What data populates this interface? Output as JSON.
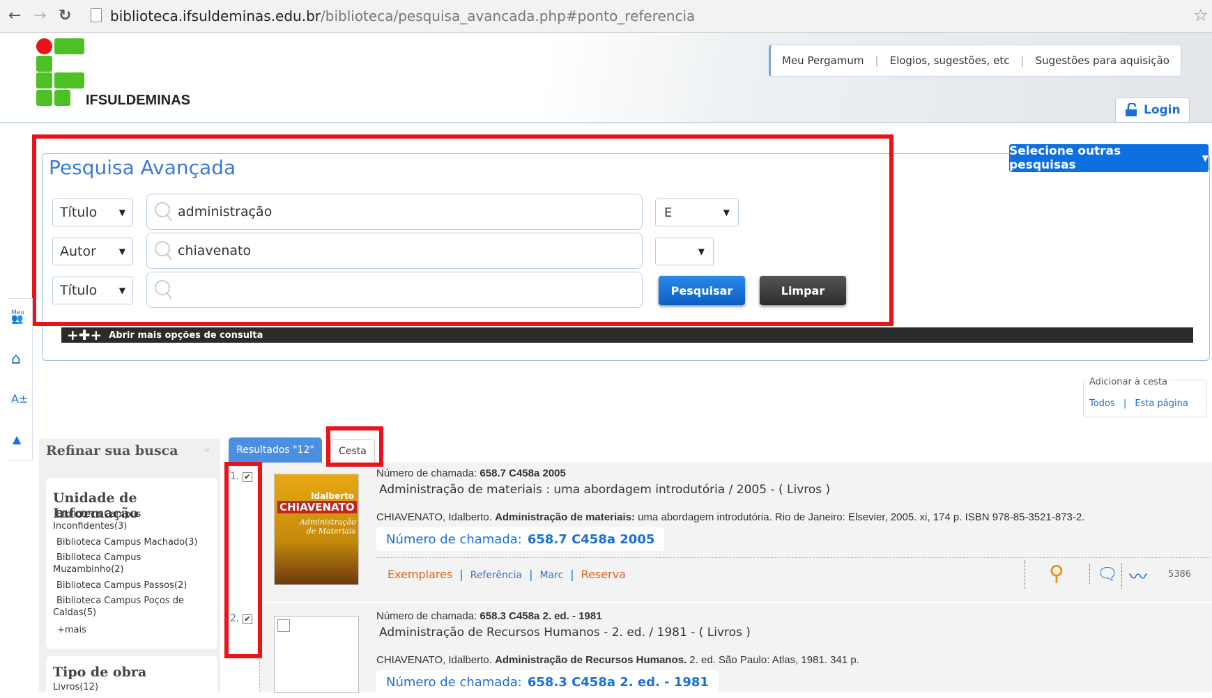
{
  "browser": {
    "url_domain": "biblioteca.ifsuldeminas.edu.br",
    "url_path": "/biblioteca/pesquisa_avancada.php#ponto_referencia"
  },
  "header": {
    "logo_text": "IFSULDEMINAS",
    "links": [
      "Meu Pergamum",
      "Elogios, sugestões, etc",
      "Sugestões para aquisição"
    ],
    "login": "Login"
  },
  "search": {
    "title": "Pesquisa Avançada",
    "other_searches": "Selecione outras pesquisas",
    "rows": [
      {
        "field": "Título",
        "term": "administração",
        "operator": "E"
      },
      {
        "field": "Autor",
        "term": "chiavenato",
        "operator": ""
      },
      {
        "field": "Título",
        "term": ""
      }
    ],
    "search_button": "Pesquisar",
    "clear_button": "Limpar",
    "more_options": "Abrir mais opções de consulta"
  },
  "sidetools": {
    "meu_label": "Meu",
    "font_label": "A±"
  },
  "basket": {
    "legend": "Adicionar à cesta",
    "all": "Todos",
    "this_page": "Esta página"
  },
  "refine": {
    "title": "Refinar sua busca",
    "unit_title": "Unidade de Informação",
    "units": [
      "Biblioteca Campus Inconfidentes(3)",
      "Biblioteca Campus Machado(3)",
      "Biblioteca Campus Muzambinho(2)",
      "Biblioteca Campus Passos(2)",
      "Biblioteca Campus Poços de Caldas(5)"
    ],
    "more": "+mais",
    "type_title": "Tipo de obra",
    "types": [
      "Livros(12)"
    ]
  },
  "tabs": {
    "results": "Resultados \"12\"",
    "basket": "Cesta"
  },
  "results": [
    {
      "num": "1.",
      "call_line": "Número de chamada: ",
      "call_value": "658.7 C458a 2005",
      "title_line": "Administração de materiais : uma abordagem introdutória / 2005 - ( Livros )",
      "ref_author": "CHIAVENATO, Idalberto. ",
      "ref_title": "Administração de materiais:",
      "ref_rest": " uma abordagem introdutória. Rio de Janeiro: Elsevier, 2005. xi, 174 p. ISBN 978-85-3521-873-2.",
      "call_box_label": "Número de chamada:",
      "call_box_value": "658.7 C458a 2005",
      "cover_author": "Idalberto",
      "cover_name": "CHIAVENATO",
      "cover_title": "Administração de Materiais",
      "actions": [
        "Exemplares",
        "Referência",
        "Marc",
        "Reserva"
      ],
      "views": "5386"
    },
    {
      "num": "2.",
      "call_line": "Número de chamada: ",
      "call_value": "658.3 C458a 2. ed. - 1981",
      "title_line": "Administração de Recursos Humanos - 2. ed. / 1981 - ( Livros )",
      "ref_author": "CHIAVENATO, Idalberto. ",
      "ref_title": "Administração de Recursos Humanos.",
      "ref_rest": " 2. ed. São Paulo: Atlas, 1981. 341 p.",
      "call_box_label": "Número de chamada:",
      "call_box_value": "658.3 C458a 2. ed. - 1981"
    }
  ]
}
